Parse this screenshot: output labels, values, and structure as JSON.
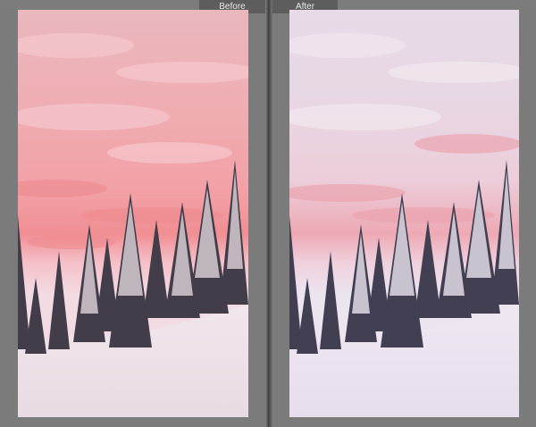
{
  "compare_view": {
    "before_label": "Before",
    "after_label": "After"
  },
  "photos": {
    "subject": "snowy-pine-forest-at-pink-sunset",
    "before_colors": {
      "sky_top": "#ebb1b6",
      "sky_mid": "#f1a2a6",
      "sky_low": "#f08f91",
      "horizon": "#f2d0da",
      "snow": "#ede4ea",
      "trees": "#3f3a44"
    },
    "after_colors": {
      "sky_top": "#e8dde9",
      "sky_mid": "#ecd3df",
      "sky_low": "#eea5b0",
      "horizon": "#ede7f3",
      "snow": "#ede6f1",
      "trees": "#3e3d4e"
    }
  },
  "ui_colors": {
    "background": "#7b7b7b",
    "tab_bg": "#5d5d5d",
    "tab_text": "#e9e9e9",
    "divider": "#3a3a3a"
  }
}
